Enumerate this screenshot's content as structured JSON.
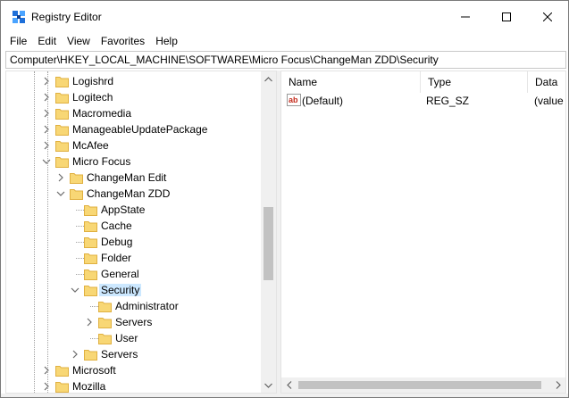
{
  "window": {
    "title": "Registry Editor",
    "icon": "registry-editor-icon"
  },
  "menu": [
    "File",
    "Edit",
    "View",
    "Favorites",
    "Help"
  ],
  "address": "Computer\\HKEY_LOCAL_MACHINE\\SOFTWARE\\Micro Focus\\ChangeMan ZDD\\Security",
  "tree": [
    {
      "label": "Logishrd",
      "level": 0,
      "state": "collapsed"
    },
    {
      "label": "Logitech",
      "level": 0,
      "state": "collapsed"
    },
    {
      "label": "Macromedia",
      "level": 0,
      "state": "collapsed"
    },
    {
      "label": "ManageableUpdatePackage",
      "level": 0,
      "state": "collapsed"
    },
    {
      "label": "McAfee",
      "level": 0,
      "state": "collapsed"
    },
    {
      "label": "Micro Focus",
      "level": 0,
      "state": "expanded"
    },
    {
      "label": "ChangeMan Edit",
      "level": 1,
      "state": "collapsed"
    },
    {
      "label": "ChangeMan ZDD",
      "level": 1,
      "state": "expanded"
    },
    {
      "label": "AppState",
      "level": 2,
      "state": "leaf"
    },
    {
      "label": "Cache",
      "level": 2,
      "state": "leaf"
    },
    {
      "label": "Debug",
      "level": 2,
      "state": "leaf"
    },
    {
      "label": "Folder",
      "level": 2,
      "state": "leaf"
    },
    {
      "label": "General",
      "level": 2,
      "state": "leaf"
    },
    {
      "label": "Security",
      "level": 2,
      "state": "expanded",
      "selected": true
    },
    {
      "label": "Administrator",
      "level": 3,
      "state": "leaf"
    },
    {
      "label": "Servers",
      "level": 3,
      "state": "collapsed"
    },
    {
      "label": "User",
      "level": 3,
      "state": "leaf"
    },
    {
      "label": "Servers",
      "level": 2,
      "state": "collapsed"
    },
    {
      "label": "Microsoft",
      "level": 0,
      "state": "collapsed"
    },
    {
      "label": "Mozilla",
      "level": 0,
      "state": "collapsed"
    }
  ],
  "columns": [
    "Name",
    "Type",
    "Data"
  ],
  "values": [
    {
      "name": "(Default)",
      "type": "REG_SZ",
      "data": "(value not set)",
      "icon": "string-value-icon"
    }
  ],
  "colors": {
    "folder": "#f8d775",
    "folder_dark": "#e0b040",
    "selection": "#cce8ff",
    "ab_icon_red": "#c42b1c"
  }
}
